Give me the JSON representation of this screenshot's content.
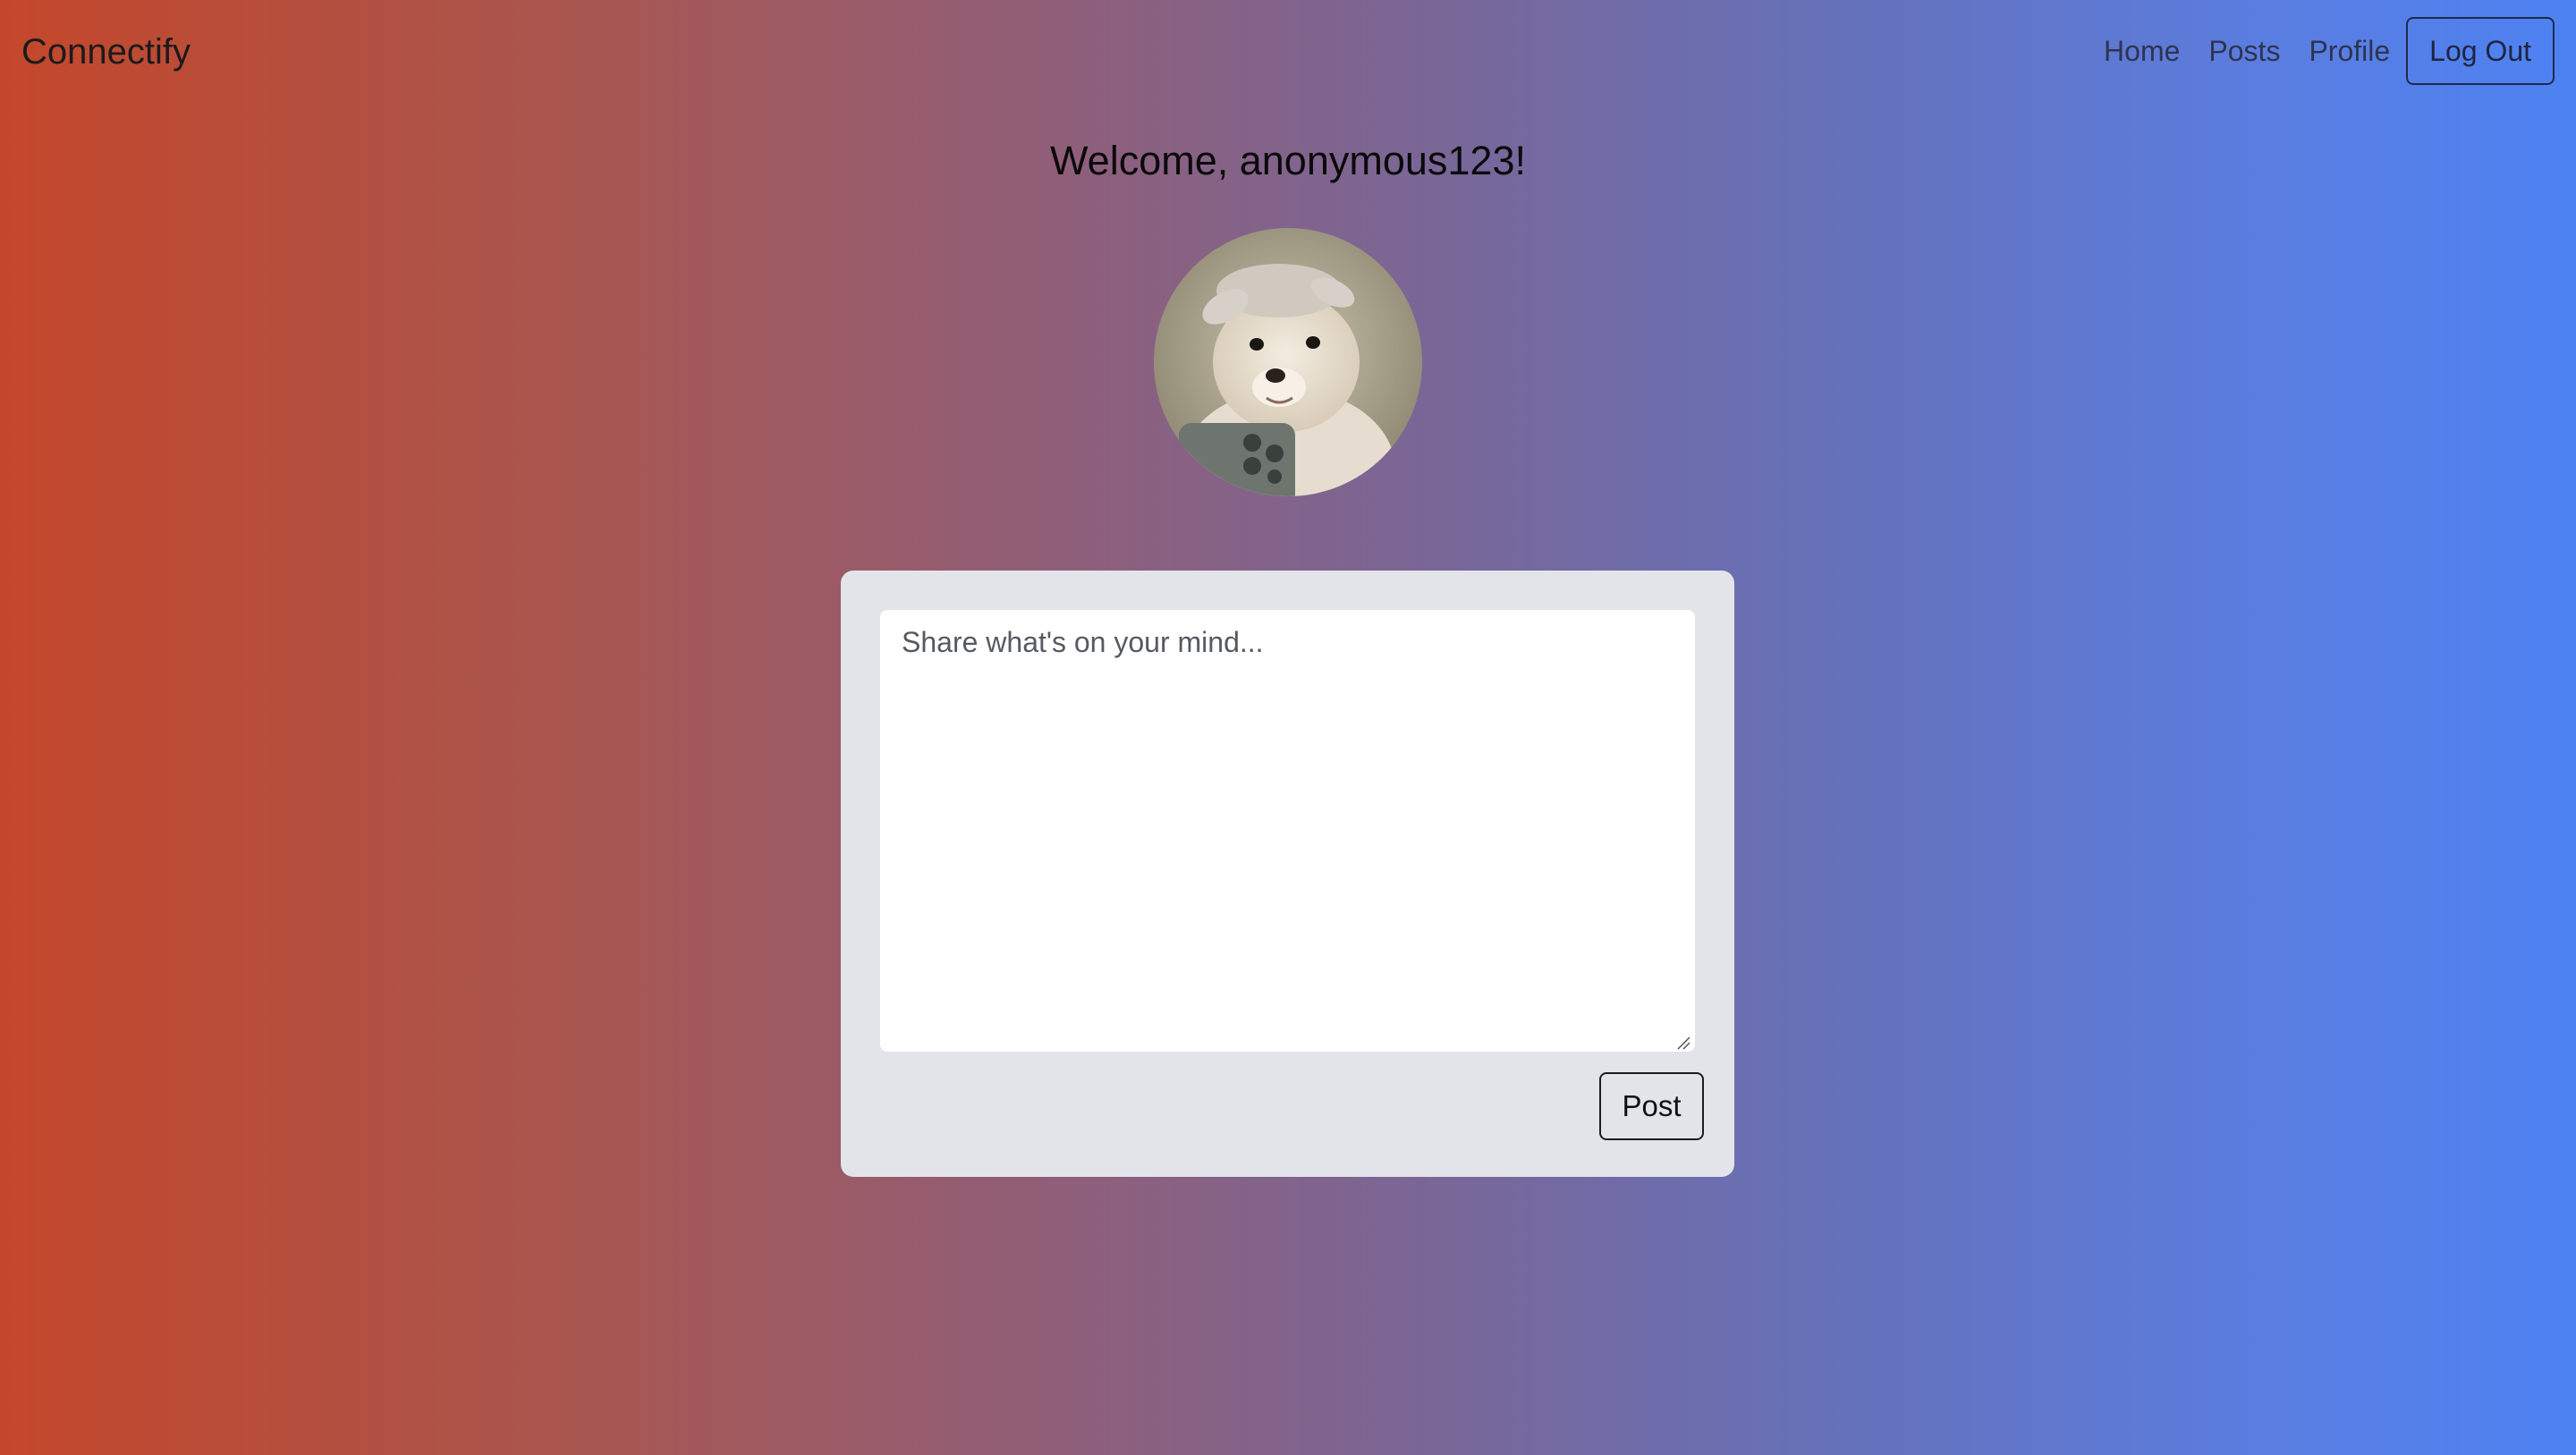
{
  "navbar": {
    "brand": "Connectify",
    "links": [
      "Home",
      "Posts",
      "Profile"
    ],
    "logout_label": "Log Out"
  },
  "main": {
    "welcome_text": "Welcome, anonymous123!",
    "avatar_icon": "profile-avatar-dog"
  },
  "composer": {
    "placeholder": "Share what's on your mind...",
    "value": "",
    "post_label": "Post"
  },
  "colors": {
    "gradient_start": "#c4472b",
    "gradient_end": "#4d82f2",
    "card_background": "#e3e4ea"
  }
}
